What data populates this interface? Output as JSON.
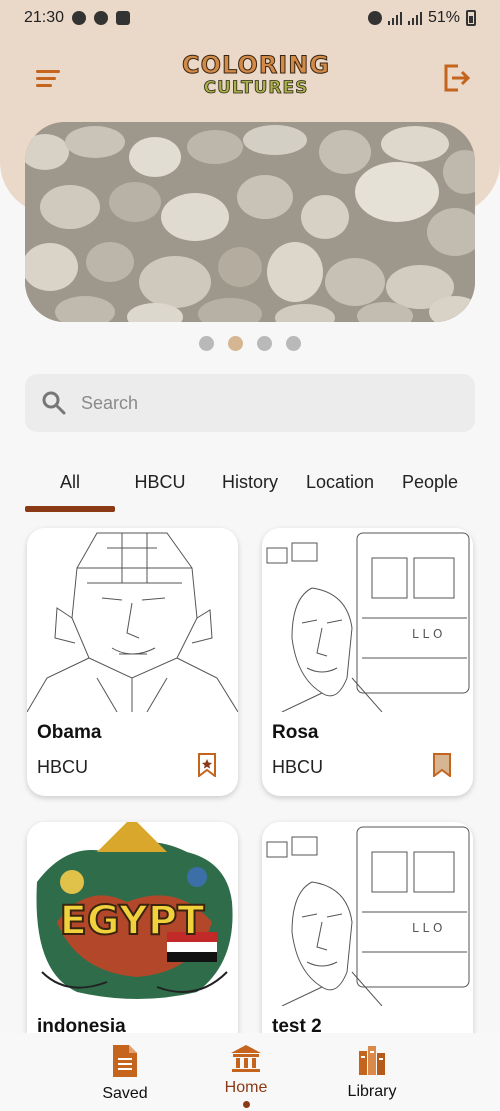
{
  "status_bar": {
    "time": "21:30",
    "battery": "51%"
  },
  "header": {
    "logo_line1": "COLORING",
    "logo_line2": "CULTURES"
  },
  "banner": {
    "slides": 4,
    "active_slide": 2
  },
  "search": {
    "placeholder": "Search",
    "value": ""
  },
  "tabs": [
    {
      "label": "All",
      "active": true
    },
    {
      "label": "HBCU",
      "active": false
    },
    {
      "label": "History",
      "active": false
    },
    {
      "label": "Location",
      "active": false
    },
    {
      "label": "People",
      "active": false
    }
  ],
  "cards": [
    {
      "title": "Obama",
      "category": "HBCU",
      "bookmarked": true
    },
    {
      "title": "Rosa",
      "category": "HBCU",
      "bookmarked": true
    },
    {
      "title": "indonesia",
      "category": ""
    },
    {
      "title": "test 2",
      "category": ""
    }
  ],
  "card_art": {
    "egypt_text": "EGYPT"
  },
  "bottom_nav": [
    {
      "label": "Saved",
      "icon": "document-icon",
      "active": false
    },
    {
      "label": "Home",
      "icon": "home-icon",
      "active": true
    },
    {
      "label": "Library",
      "icon": "books-icon",
      "active": false
    }
  ],
  "colors": {
    "accent": "#8a3a14",
    "icon_orange": "#c4641d",
    "header_bg": "#ead8c9"
  }
}
